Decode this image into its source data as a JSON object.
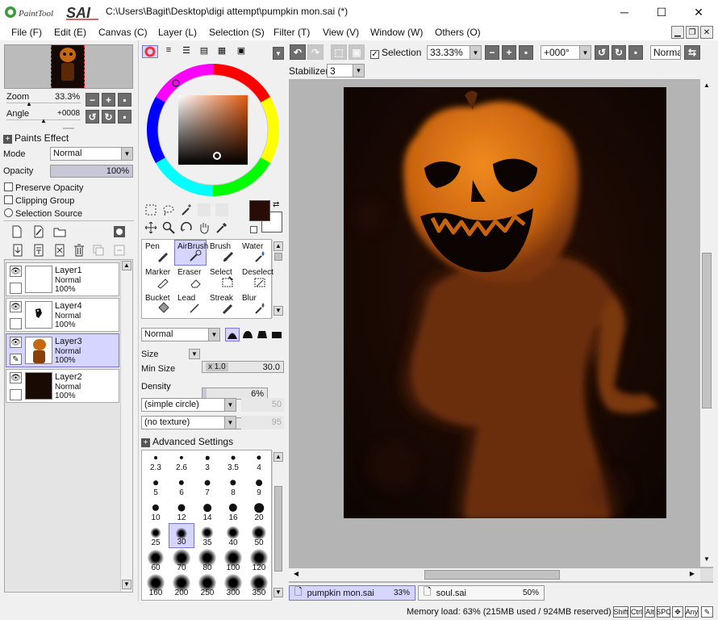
{
  "app": {
    "logo_text": "PaintTool SAI",
    "title": "C:\\Users\\Bagit\\Desktop\\digi attempt\\pumpkin mon.sai (*)"
  },
  "menu": [
    "File (F)",
    "Edit (E)",
    "Canvas (C)",
    "Layer (L)",
    "Selection (S)",
    "Filter (T)",
    "View (V)",
    "Window (W)",
    "Others (O)"
  ],
  "navigator": {
    "zoom_label": "Zoom",
    "zoom_value": "33.3%",
    "angle_label": "Angle",
    "angle_value": "+0008"
  },
  "layer_props": {
    "paints_effect": "Paints Effect",
    "mode_label": "Mode",
    "mode_value": "Normal",
    "opacity_label": "Opacity",
    "opacity_value": "100%",
    "opacity_fraction": 1.0,
    "preserve_opacity": "Preserve Opacity",
    "clipping_group": "Clipping Group",
    "selection_source": "Selection Source"
  },
  "layers": [
    {
      "name": "Layer1",
      "mode": "Normal",
      "opacity": "100%",
      "selected": false
    },
    {
      "name": "Layer4",
      "mode": "Normal",
      "opacity": "100%",
      "selected": false
    },
    {
      "name": "Layer3",
      "mode": "Normal",
      "opacity": "100%",
      "selected": true
    },
    {
      "name": "Layer2",
      "mode": "Normal",
      "opacity": "100%",
      "selected": false
    }
  ],
  "tools": [
    {
      "label": "Pen",
      "selected": false
    },
    {
      "label": "AirBrush",
      "selected": true
    },
    {
      "label": "Brush",
      "selected": false
    },
    {
      "label": "Water",
      "selected": false
    },
    {
      "label": "Marker",
      "selected": false
    },
    {
      "label": "Eraser",
      "selected": false
    },
    {
      "label": "Select",
      "selected": false
    },
    {
      "label": "Deselect",
      "selected": false
    },
    {
      "label": "Bucket",
      "selected": false
    },
    {
      "label": "Lead",
      "selected": false
    },
    {
      "label": "Streak",
      "selected": false
    },
    {
      "label": "Blur",
      "selected": false
    }
  ],
  "brush_settings": {
    "blend_mode": "Normal",
    "size_label": "Size",
    "size_multiplier": "x 1.0",
    "size_value": "30.0",
    "min_size_label": "Min Size",
    "min_size_value": "6%",
    "min_size_fraction": 0.06,
    "density_label": "Density",
    "density_value": "5",
    "density_fraction": 0.05,
    "shape": "(simple circle)",
    "shape_value": "50",
    "texture": "(no texture)",
    "texture_value": "95",
    "advanced": "Advanced Settings"
  },
  "brush_sizes": [
    "2.3",
    "2.6",
    "3",
    "3.5",
    "4",
    "5",
    "6",
    "7",
    "8",
    "9",
    "10",
    "12",
    "14",
    "16",
    "20",
    "25",
    "30",
    "35",
    "40",
    "50",
    "60",
    "70",
    "80",
    "100",
    "120",
    "160",
    "200",
    "250",
    "300",
    "350"
  ],
  "selected_brush_size": "30",
  "toolbar": {
    "selection_label": "Selection",
    "zoom_value": "33.33%",
    "rotation_value": "+000°",
    "blend_mode": "Normal",
    "stabilizer_label": "Stabilizer",
    "stabilizer_value": "3"
  },
  "colors": {
    "primary": "#2a0c06",
    "secondary": "#ffffff",
    "accent_selected": "#d5d5ff"
  },
  "documents": [
    {
      "name": "pumpkin mon.sai",
      "zoom": "33%",
      "active": true
    },
    {
      "name": "soul.sai",
      "zoom": "50%",
      "active": false
    }
  ],
  "status": {
    "memory": "Memory load: 63% (215MB used / 924MB reserved)",
    "keys": [
      "Shift",
      "Ctrl",
      "Alt",
      "SPC",
      "Any"
    ]
  }
}
